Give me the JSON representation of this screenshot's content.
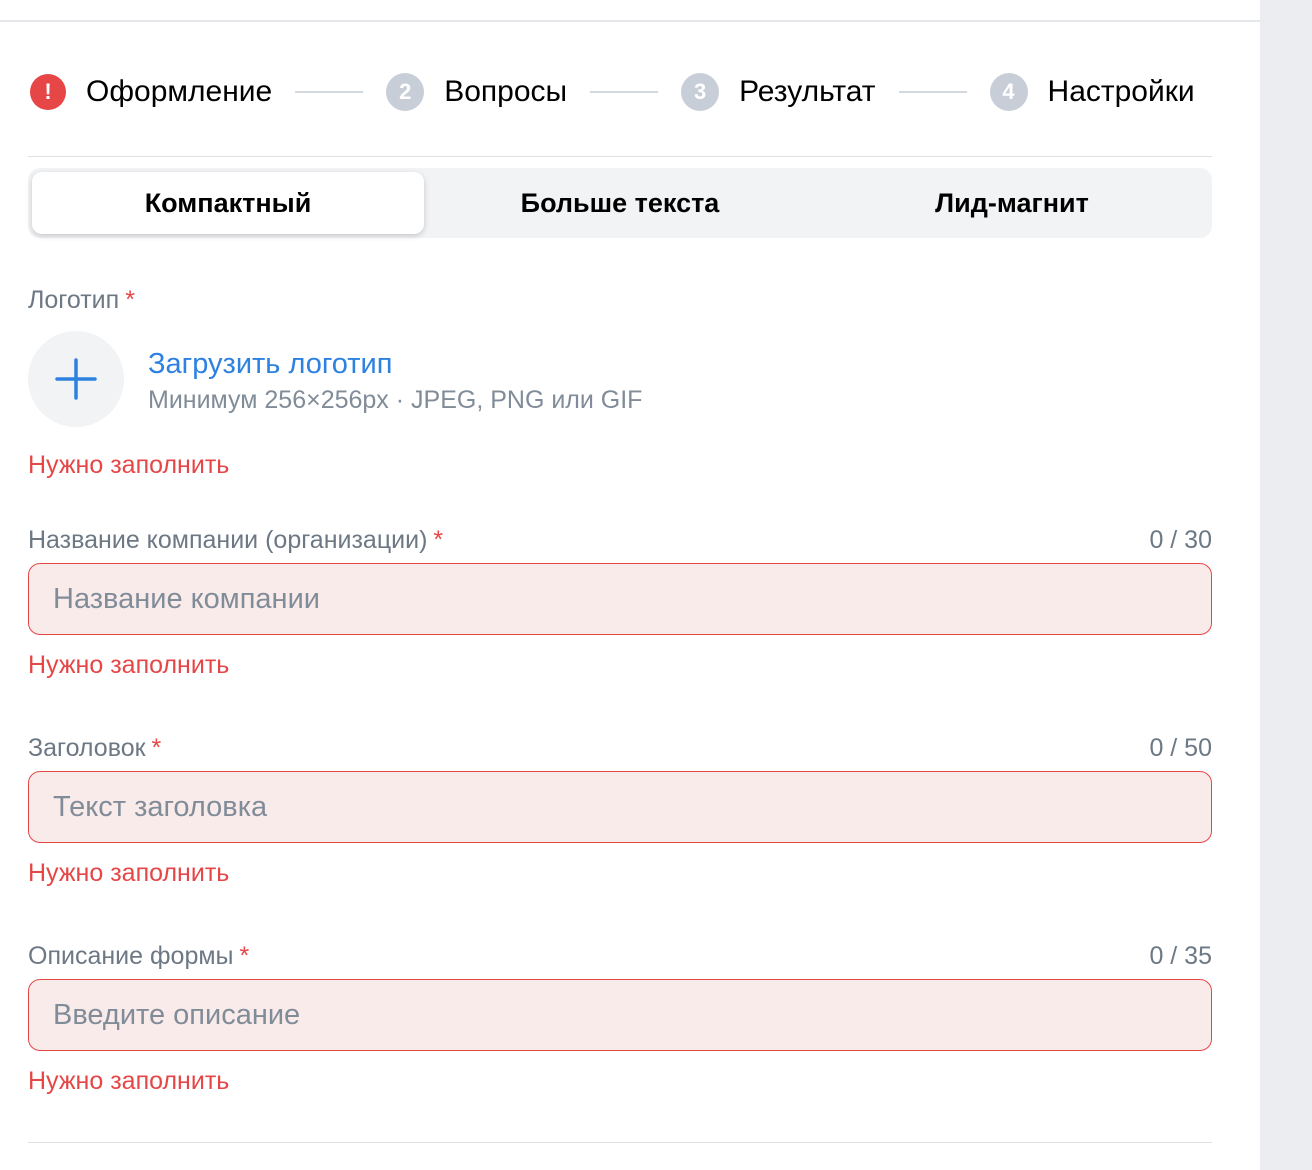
{
  "stepper": {
    "steps": [
      {
        "badge": "!",
        "label": "Оформление",
        "state": "error"
      },
      {
        "badge": "2",
        "label": "Вопросы",
        "state": "inactive"
      },
      {
        "badge": "3",
        "label": "Результат",
        "state": "inactive"
      },
      {
        "badge": "4",
        "label": "Настройки",
        "state": "inactive"
      }
    ]
  },
  "layout_tabs": {
    "items": [
      {
        "label": "Компактный",
        "active": true
      },
      {
        "label": "Больше текста",
        "active": false
      },
      {
        "label": "Лид-магнит",
        "active": false
      }
    ]
  },
  "logo": {
    "label": "Логотип",
    "required_mark": "*",
    "upload_text": "Загрузить логотип",
    "hint": "Минимум 256×256px · JPEG, PNG или GIF",
    "error": "Нужно заполнить",
    "icon": "plus-icon"
  },
  "company_name": {
    "label": "Название компании (организации)",
    "required_mark": "*",
    "counter": "0 / 30",
    "value": "",
    "placeholder": "Название компании",
    "error": "Нужно заполнить"
  },
  "heading": {
    "label": "Заголовок",
    "required_mark": "*",
    "counter": "0 / 50",
    "value": "",
    "placeholder": "Текст заголовка",
    "error": "Нужно заполнить"
  },
  "description": {
    "label": "Описание формы",
    "required_mark": "*",
    "counter": "0 / 35",
    "value": "",
    "placeholder": "Введите описание",
    "error": "Нужно заполнить"
  },
  "colors": {
    "error": "#e64646",
    "link": "#2d81e0",
    "muted": "#6d7885",
    "badge_inactive": "#c8ced8",
    "input_error_bg": "#faebeb"
  }
}
